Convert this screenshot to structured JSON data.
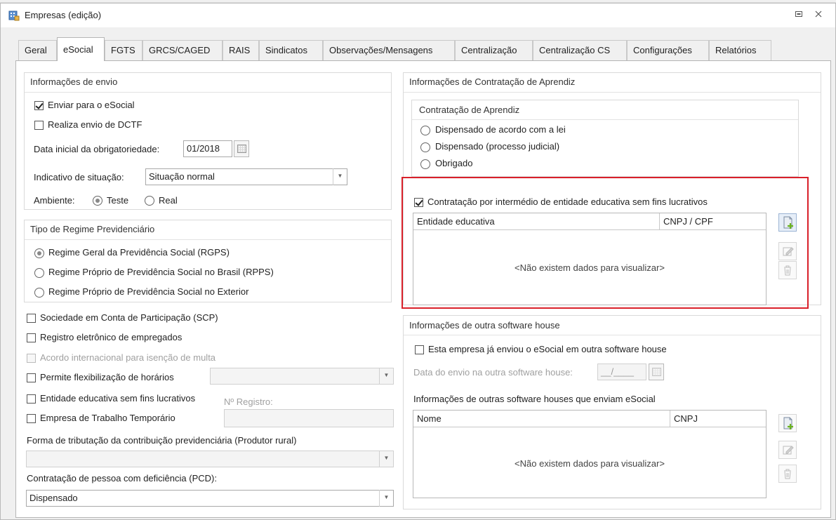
{
  "window": {
    "title": "Empresas (edição)"
  },
  "tabs": [
    {
      "label": "Geral"
    },
    {
      "label": "eSocial"
    },
    {
      "label": "FGTS"
    },
    {
      "label": "GRCS/CAGED"
    },
    {
      "label": "RAIS"
    },
    {
      "label": "Sindicatos"
    },
    {
      "label": "Observações/Mensagens"
    },
    {
      "label": "Centralização"
    },
    {
      "label": "Centralização CS"
    },
    {
      "label": "Configurações"
    },
    {
      "label": "Relatórios"
    }
  ],
  "envio": {
    "title": "Informações de envio",
    "enviar_esocial": "Enviar para o eSocial",
    "realiza_dctf": "Realiza envio de DCTF",
    "data_inicial_label": "Data inicial da obrigatoriedade:",
    "data_inicial_value": "01/2018",
    "indicativo_label": "Indicativo de situação:",
    "indicativo_value": "Situação normal",
    "ambiente_label": "Ambiente:",
    "ambiente_teste": "Teste",
    "ambiente_real": "Real"
  },
  "regime": {
    "title": "Tipo de Regime Previdenciário",
    "options": [
      "Regime Geral da Previdência Social (RGPS)",
      "Regime Próprio de Previdência Social no Brasil (RPPS)",
      "Regime Próprio de Previdência Social no Exterior"
    ]
  },
  "opcoes": {
    "scp": "Sociedade em Conta de Participação (SCP)",
    "registro_eletronico": "Registro eletrônico de empregados",
    "acordo_internacional": "Acordo internacional para isenção de multa",
    "flexibilizacao": "Permite flexibilização de horários",
    "entidade_educativa": "Entidade educativa sem fins lucrativos",
    "n_registro_label": "Nº Registro:",
    "trabalho_temporario": "Empresa de Trabalho Temporário",
    "forma_tributacao_label": "Forma de tributação da contribuição previdenciária (Produtor rural)",
    "forma_tributacao_value": "",
    "pcd_label": "Contratação de pessoa com deficiência (PCD):",
    "pcd_value": "Dispensado"
  },
  "aprendiz": {
    "title": "Informações de Contratação de Aprendiz",
    "sub_title": "Contratação de Aprendiz",
    "options": [
      "Dispensado de acordo com a lei",
      "Dispensado (processo judicial)",
      "Obrigado"
    ],
    "intermedio_label": "Contratação por intermédio de entidade educativa sem fins lucrativos",
    "grid_cols": [
      "Entidade educativa",
      "CNPJ / CPF"
    ],
    "grid_empty": "<Não existem dados para visualizar>"
  },
  "software_house": {
    "title": "Informações de outra software house",
    "ja_enviou_label": "Esta empresa já enviou o eSocial em outra software house",
    "data_envio_label": "Data do envio na outra software house:",
    "data_envio_value": "__/____",
    "grid_title": "Informações de outras software houses que enviam eSocial",
    "grid_cols": [
      "Nome",
      "CNPJ"
    ],
    "grid_empty": "<Não existem dados para visualizar>"
  }
}
